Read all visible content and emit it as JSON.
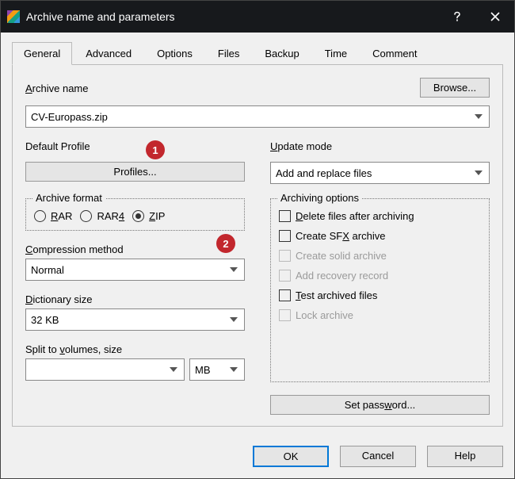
{
  "window": {
    "title": "Archive name and parameters"
  },
  "tabs": {
    "items": [
      {
        "label": "General"
      },
      {
        "label": "Advanced"
      },
      {
        "label": "Options"
      },
      {
        "label": "Files"
      },
      {
        "label": "Backup"
      },
      {
        "label": "Time"
      },
      {
        "label": "Comment"
      }
    ],
    "active_index": 0
  },
  "archive_name": {
    "label": "Archive name",
    "value": "CV-Europass.zip",
    "browse": "Browse..."
  },
  "default_profile": {
    "label": "Default Profile",
    "button": "Profiles..."
  },
  "update_mode": {
    "label": "Update mode",
    "value": "Add and replace files"
  },
  "archive_format": {
    "legend": "Archive format",
    "options": [
      {
        "label": "RAR",
        "selected": false
      },
      {
        "label": "RAR4",
        "selected": false
      },
      {
        "label": "ZIP",
        "selected": true
      }
    ]
  },
  "compression_method": {
    "label": "Compression method",
    "value": "Normal"
  },
  "dictionary_size": {
    "label": "Dictionary size",
    "value": "32 KB"
  },
  "split_volumes": {
    "label": "Split to volumes, size",
    "value": "",
    "unit": "MB"
  },
  "archiving_options": {
    "legend": "Archiving options",
    "items": [
      {
        "label": "Delete files after archiving",
        "checked": false,
        "enabled": true
      },
      {
        "label": "Create SFX archive",
        "checked": false,
        "enabled": true
      },
      {
        "label": "Create solid archive",
        "checked": false,
        "enabled": false
      },
      {
        "label": "Add recovery record",
        "checked": false,
        "enabled": false
      },
      {
        "label": "Test archived files",
        "checked": false,
        "enabled": true
      },
      {
        "label": "Lock archive",
        "checked": false,
        "enabled": false
      }
    ]
  },
  "set_password": "Set password...",
  "buttons": {
    "ok": "OK",
    "cancel": "Cancel",
    "help": "Help"
  },
  "annotations": {
    "b1": "1",
    "b2": "2"
  }
}
